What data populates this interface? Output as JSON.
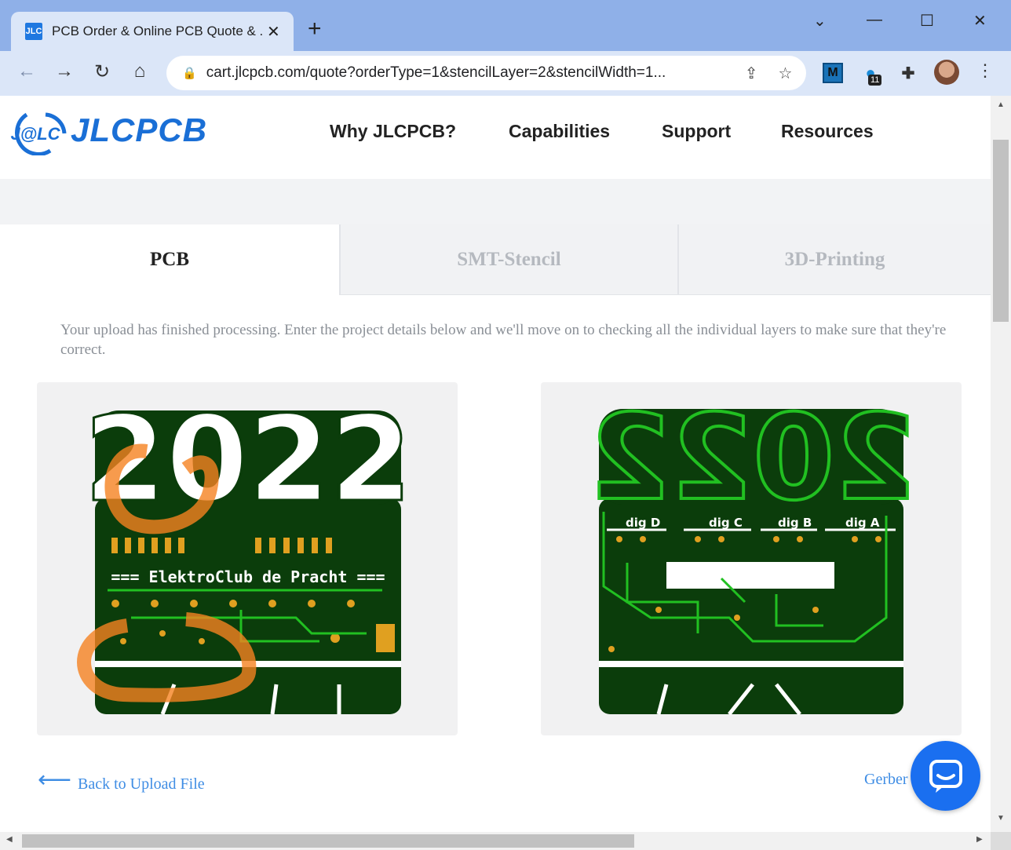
{
  "browser": {
    "tab_title": "PCB Order & Online PCB Quote & ...",
    "favicon_text": "JLC",
    "url": "cart.jlcpcb.com/quote?orderType=1&stencilLayer=2&stencilWidth=1...",
    "extension_badge": "11"
  },
  "site": {
    "logo_mark": "J@LC",
    "logo_text": "JLCPCB",
    "nav": [
      "Why JLCPCB?",
      "Capabilities",
      "Support",
      "Resources"
    ]
  },
  "service_tabs": [
    {
      "label": "PCB",
      "active": true
    },
    {
      "label": "SMT-Stencil",
      "active": false
    },
    {
      "label": "3D-Printing",
      "active": false
    }
  ],
  "notice": "Your upload has finished processing. Enter the project details below and we'll move on to checking all the individual layers to make sure that they're correct.",
  "previews": {
    "top": {
      "year": "2022",
      "banner": "=== ElektroClub de Pracht ==="
    },
    "bottom": {
      "year": "2022",
      "digits": [
        "dig D",
        "dig C",
        "dig B",
        "dig A"
      ]
    }
  },
  "footer": {
    "back_label": "Back to Upload File",
    "gerber_label": "Gerber"
  },
  "colors": {
    "brand_blue": "#1a6fd6",
    "link_blue": "#3f8de4",
    "pcb_green": "#0b3d0b",
    "trace_green": "#21c021",
    "pad_gold": "#e0a020",
    "highlight_orange": "#f58220"
  }
}
